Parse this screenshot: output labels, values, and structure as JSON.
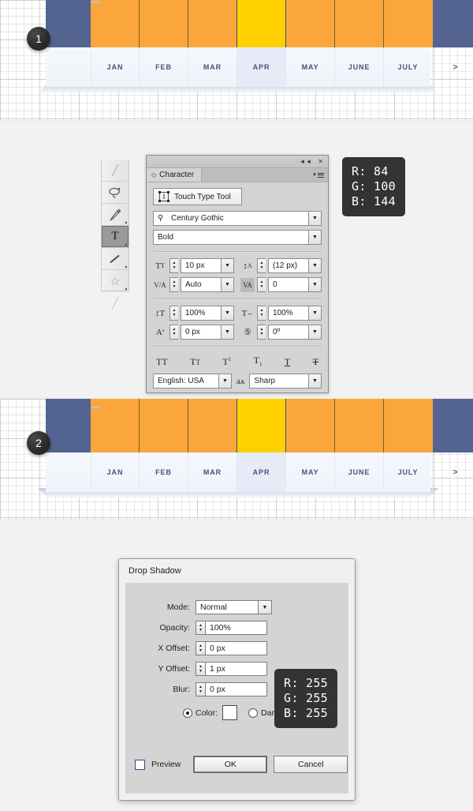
{
  "steps": [
    {
      "number": "1"
    },
    {
      "number": "2"
    }
  ],
  "month_widget": {
    "months": [
      {
        "label": "JAN",
        "active": false
      },
      {
        "label": "FEB",
        "active": false
      },
      {
        "label": "MAR",
        "active": false
      },
      {
        "label": "APR",
        "active": true
      },
      {
        "label": "MAY",
        "active": false
      },
      {
        "label": "JUNE",
        "active": false
      },
      {
        "label": "JULY",
        "active": false
      }
    ],
    "next_label": ">",
    "colors": {
      "bar_default": "#fba63c",
      "bar_active": "#ffd000",
      "cap": "#546490",
      "label_text": "#45527d",
      "label_bg": "#f2f5fb",
      "label_active_bg": "#e7ebf8"
    }
  },
  "rgb_chips": [
    {
      "r": "R: 84",
      "g": "G: 100",
      "b": "B: 144"
    },
    {
      "r": "R: 255",
      "g": "G: 255",
      "b": "B: 255"
    }
  ],
  "toolbar": {
    "tools": [
      {
        "name": "paintbrush-tool",
        "glyph": "╱"
      },
      {
        "name": "lasso-tool",
        "glyph": "❦"
      },
      {
        "name": "pen-tool",
        "glyph": "✒"
      },
      {
        "name": "type-tool",
        "glyph": "T"
      },
      {
        "name": "line-segment-tool",
        "glyph": "╱"
      },
      {
        "name": "star-tool",
        "glyph": "☆"
      },
      {
        "name": "paintbrush-tool-2",
        "glyph": "╱"
      }
    ]
  },
  "character_panel": {
    "title": "Character",
    "collapse_icon": "◄◄",
    "close_icon": "✕",
    "touch_type_tool": "Touch Type Tool",
    "font_family": "Century Gothic",
    "font_style": "Bold",
    "font_size": "10 px",
    "leading": "(12 px)",
    "kerning": "Auto",
    "tracking": "0",
    "vertical_scale": "100%",
    "horizontal_scale": "100%",
    "baseline_shift": "0 px",
    "character_rotation": "0º",
    "language": "English: USA",
    "antialias": "Sharp",
    "style_buttons": [
      {
        "name": "all-caps",
        "label": "TT"
      },
      {
        "name": "small-caps",
        "label": "Tᴛ"
      },
      {
        "name": "superscript",
        "label": "T"
      },
      {
        "name": "subscript",
        "label": "T"
      },
      {
        "name": "underline",
        "label": "T"
      },
      {
        "name": "strikethrough",
        "label": "T"
      }
    ],
    "caret": "▼",
    "spin_up": "▲",
    "spin_down": "▼",
    "search_icon": "⌕",
    "aa_icon": "aᴀ"
  },
  "drop_shadow": {
    "title": "Drop Shadow",
    "mode_label": "Mode:",
    "mode_value": "Normal",
    "opacity_label": "Opacity:",
    "opacity_value": "100%",
    "x_offset_label": "X Offset:",
    "x_offset_value": "0 px",
    "y_offset_label": "Y Offset:",
    "y_offset_value": "1 px",
    "blur_label": "Blur:",
    "blur_value": "0 px",
    "color_label": "Color:",
    "darkness_label": "Darkness:",
    "preview_label": "Preview",
    "ok_label": "OK",
    "cancel_label": "Cancel",
    "caret": "▼",
    "spin_up": "▲",
    "spin_down": "▼"
  }
}
